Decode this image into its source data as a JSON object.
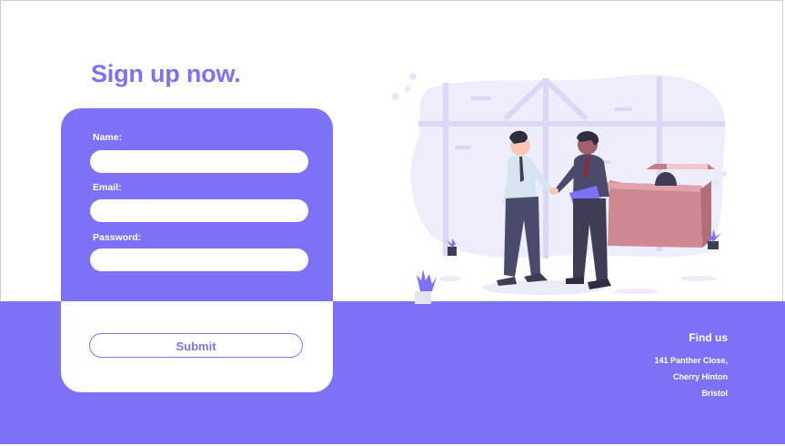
{
  "title": "Sign up now.",
  "form": {
    "name_label": "Name:",
    "email_label": "Email:",
    "password_label": "Password:",
    "name_value": "",
    "email_value": "",
    "password_value": "",
    "submit_label": "Submit"
  },
  "footer": {
    "heading": "Find us",
    "address": [
      "141 Panther Close,",
      "Cherry Hinton",
      "Bristol"
    ]
  },
  "colors": {
    "accent": "#7b72f7",
    "background": "#ffffff",
    "desk": "#d6888f"
  },
  "illustration": {
    "icon": "business-handshake-illustration"
  }
}
